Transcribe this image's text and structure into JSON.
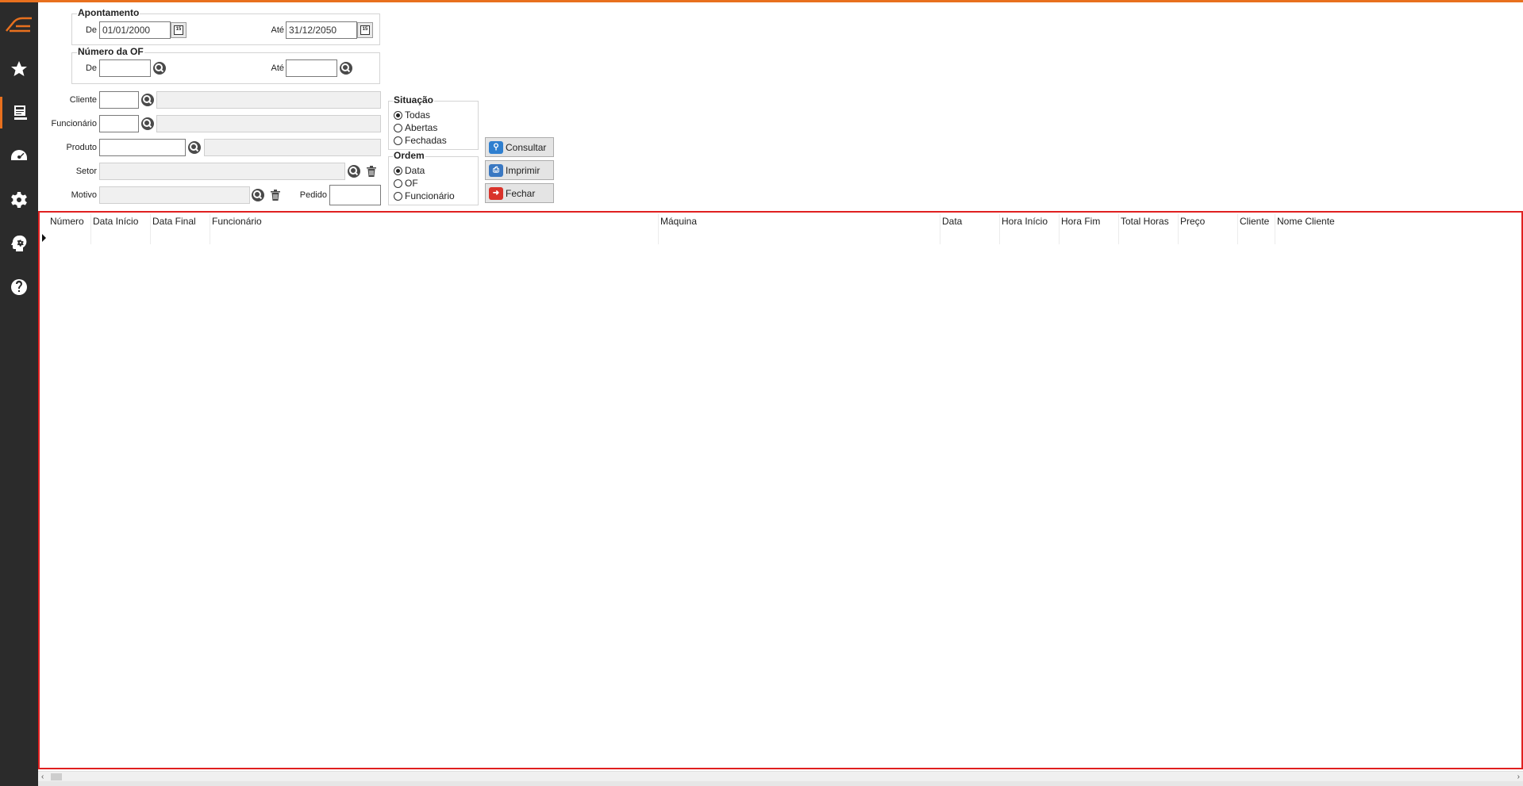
{
  "sidebar": {
    "items": [
      {
        "name": "favoritos",
        "icon": "star-icon"
      },
      {
        "name": "relatorios",
        "icon": "report-icon"
      },
      {
        "name": "dashboard",
        "icon": "gauge-icon"
      },
      {
        "name": "configuracoes",
        "icon": "gear-icon"
      },
      {
        "name": "consultoria",
        "icon": "head-gear-icon"
      },
      {
        "name": "ajuda",
        "icon": "help-icon"
      }
    ]
  },
  "filters": {
    "apontamento": {
      "title": "Apontamento",
      "de_label": "De",
      "de_value": "01/01/2000",
      "ate_label": "Até",
      "ate_value": "31/12/2050"
    },
    "numero_of": {
      "title": "Número da OF",
      "de_label": "De",
      "de_value": "",
      "ate_label": "Até",
      "ate_value": ""
    },
    "cliente_label": "Cliente",
    "funcionario_label": "Funcionário",
    "produto_label": "Produto",
    "setor_label": "Setor",
    "motivo_label": "Motivo",
    "pedido_label": "Pedido"
  },
  "situacao": {
    "title": "Situação",
    "options": [
      "Todas",
      "Abertas",
      "Fechadas"
    ],
    "selected": "Todas"
  },
  "ordem": {
    "title": "Ordem",
    "options": [
      "Data",
      "OF",
      "Funcionário"
    ],
    "selected": "Data"
  },
  "buttons": {
    "consultar": "Consultar",
    "imprimir": "Imprimir",
    "fechar": "Fechar"
  },
  "grid": {
    "columns": [
      "Número",
      "Data Início",
      "Data Final",
      "Funcionário",
      "Máquina",
      "Data",
      "Hora Início",
      "Hora Fim",
      "Total Horas",
      "Preço",
      "Cliente",
      "Nome Cliente"
    ],
    "rows": []
  },
  "colors": {
    "accent": "#e8701e",
    "sidebar": "#2b2b2b",
    "grid_border": "#e02020"
  }
}
